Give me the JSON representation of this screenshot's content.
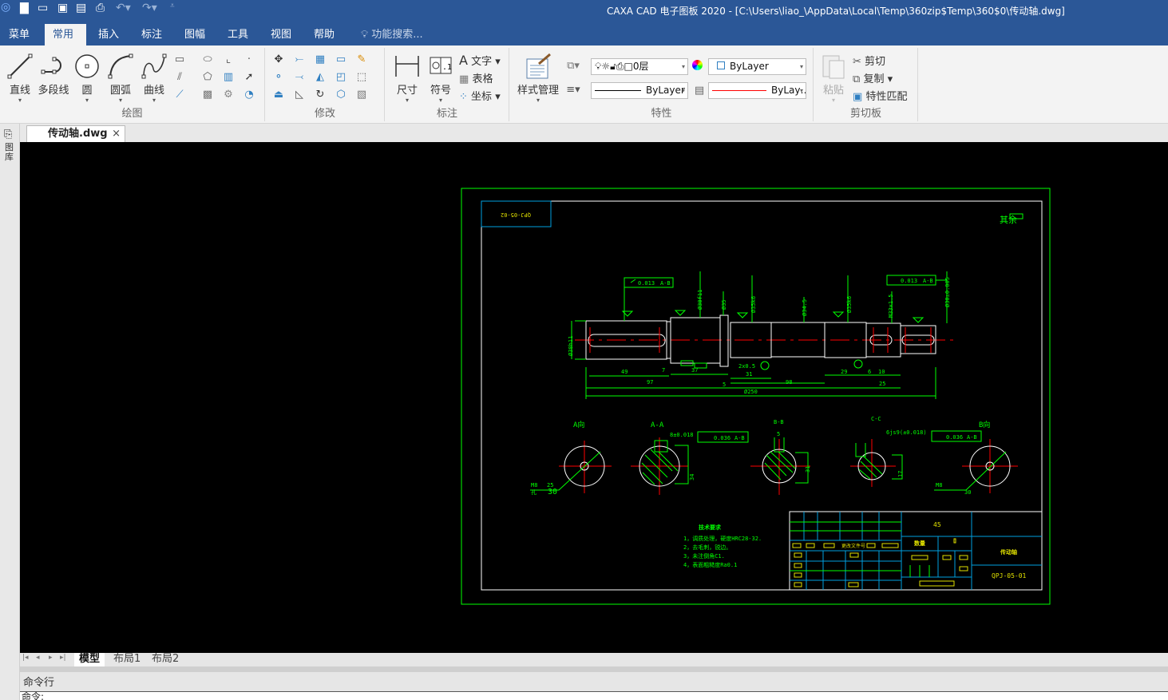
{
  "titlebar": {
    "title": "CAXA CAD 电子图板 2020 - [C:\\Users\\liao_\\AppData\\Local\\Temp\\360zip$Temp\\360$0\\传动轴.dwg]"
  },
  "menu": {
    "tabs": [
      "菜单",
      "常用",
      "插入",
      "标注",
      "图幅",
      "工具",
      "视图",
      "帮助"
    ],
    "active": "常用",
    "search_placeholder": "功能搜索..."
  },
  "ribbon": {
    "draw": {
      "label": "绘图",
      "line": "直线",
      "polyline": "多段线",
      "circle": "圆",
      "arc": "圆弧",
      "curve": "曲线"
    },
    "modify": {
      "label": "修改"
    },
    "annotate": {
      "label": "标注",
      "dimension": "尺寸",
      "symbol": "符号",
      "text": "文字",
      "table": "表格",
      "coordinate": "坐标"
    },
    "properties": {
      "label": "特性",
      "style_manager": "样式管理",
      "layer": "0层",
      "color": "ByLayer",
      "linetype": "ByLayer",
      "lineweight": "ByLay…"
    },
    "clipboard": {
      "label": "剪切板",
      "paste": "粘贴",
      "cut": "剪切",
      "copy": "复制",
      "match": "特性匹配"
    }
  },
  "document": {
    "tab": "传动轴.dwg",
    "library": "图库"
  },
  "layout_tabs": [
    "模型",
    "布局1",
    "布局2"
  ],
  "command": {
    "label": "命令行",
    "prompt": "命令:"
  },
  "colors": {
    "accent": "#2b5797",
    "canvas": "#000000",
    "dim": "#00ff00",
    "outline": "#ffffff",
    "center": "#ff0000",
    "table": "#00a0e0",
    "text": "#ffff00"
  },
  "drawing": {
    "code_mirrored": "QPJ-05-02",
    "other": "其余",
    "views": {
      "a_dir": "A向",
      "aa": "A-A",
      "bb": "B-B",
      "cc": "C-C",
      "b_dir": "B向"
    },
    "tolerances": {
      "runout": "0.013",
      "datum_ab": "A-B",
      "sym": "0.036",
      "key_aa": "8±0.018",
      "key_cc": "6js9(±0.018)"
    },
    "dims": {
      "d38": "Ø38h11",
      "d30": "Ø30f11",
      "d35a": "Ø35",
      "d35k": "Ø35k6",
      "d34": "Ø34.5",
      "d35k2": "Ø35k6",
      "m33": "M33x1.5",
      "d30b": "Ø30±0.005",
      "l49": "49",
      "l7": "7",
      "l37": "37",
      "l97": "97",
      "l5": "5",
      "l2x": "2x0.5",
      "l31": "31",
      "l98": "98",
      "l29": "29",
      "l6": "6",
      "l10": "10",
      "l25": "25",
      "l250": "Ø250",
      "s34": "34",
      "s31": "31",
      "s17": "17",
      "bb5": "5",
      "m8a": "M8",
      "m8b": "M8",
      "depth25": "25",
      "depth30a": "30",
      "depth30b": "30",
      "hole": "孔"
    },
    "tech_title": "技术要求",
    "tech_notes": [
      "1，调质处理，硬度HRC28-32.",
      "2，去毛刺，锐边。",
      "3，未注倒角C1.",
      "4，表面粗糙度Ra0.1"
    ],
    "title_block": {
      "material": "45",
      "qty_label": "数量",
      "qty": "0",
      "name": "传动轴",
      "code": "QPJ-05-01",
      "file_label": "更改文件号"
    }
  }
}
